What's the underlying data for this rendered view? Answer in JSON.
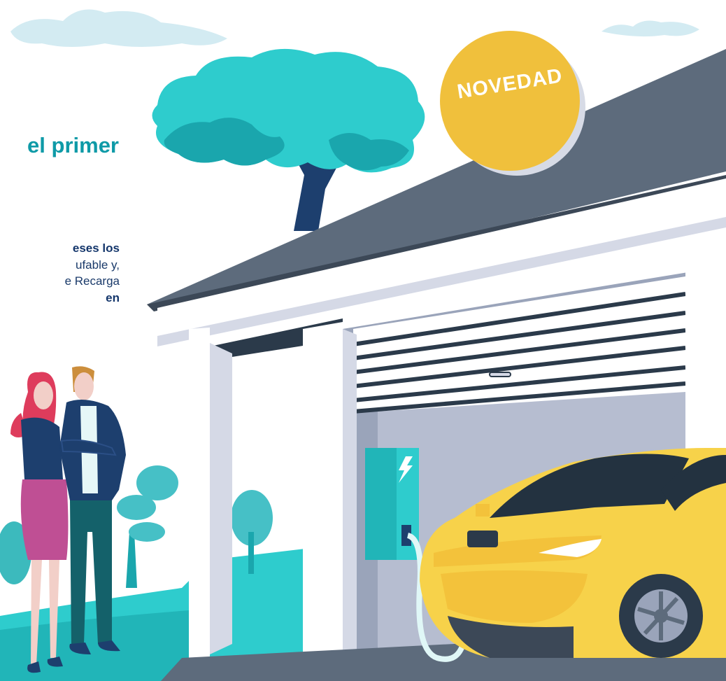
{
  "headline": "el primer",
  "body_lines": [
    {
      "text": "eses los",
      "bold": true
    },
    {
      "text": "ufable y,",
      "bold": false
    },
    {
      "text": "e Recarga",
      "bold": false
    },
    {
      "text": "en",
      "bold": true
    }
  ],
  "badge": "NOVEDAD",
  "colors": {
    "teal": "#2ecccd",
    "dark_teal": "#0e9aa7",
    "navy_text": "#14366b",
    "badge_yellow": "#f0c03c",
    "car_yellow": "#f7d24a",
    "roof": "#5d6b7c",
    "wall": "#e8ebf2"
  },
  "icons": [
    "lightning-icon",
    "charger-station",
    "electric-car",
    "garage",
    "tree",
    "cloud",
    "couple-figures"
  ]
}
